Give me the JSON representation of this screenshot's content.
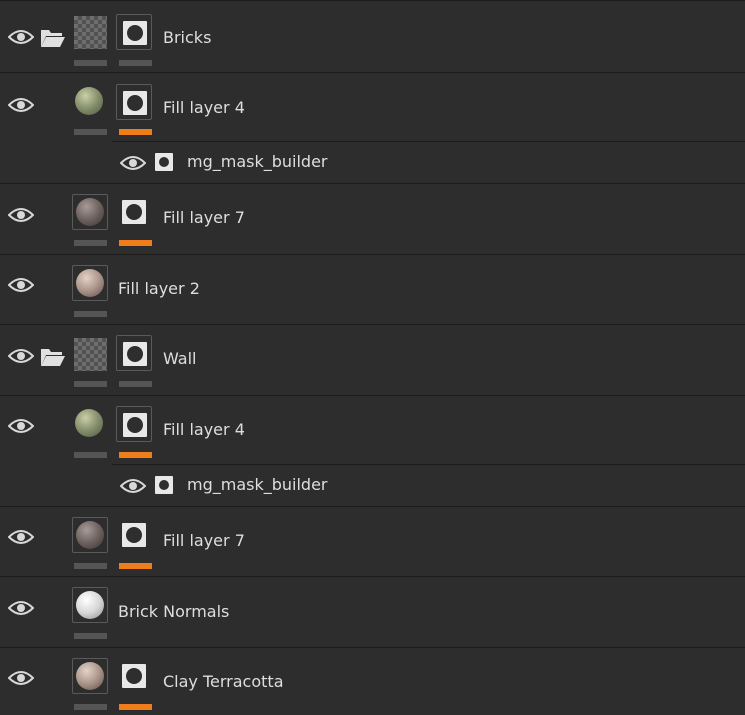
{
  "accent_color": "#ef7d1c",
  "layers": [
    {
      "name": "Bricks",
      "type": "folder",
      "visible": true,
      "content": "transparent",
      "mask": true,
      "mask_bar": "gray",
      "content_bar": "gray"
    },
    {
      "name": "Fill layer 4",
      "type": "fill",
      "visible": true,
      "content": "moss",
      "mask": true,
      "mask_bar": "orange",
      "content_bar": "gray",
      "effects": [
        {
          "name": "mg_mask_builder",
          "visible": true
        }
      ]
    },
    {
      "name": "Fill layer 7",
      "type": "fill",
      "visible": true,
      "content": "stone",
      "mask": true,
      "mask_bar": "orange",
      "content_bar": "gray"
    },
    {
      "name": "Fill layer 2",
      "type": "fill",
      "visible": true,
      "content": "clay",
      "mask": false,
      "content_bar": "gray"
    },
    {
      "name": "Wall",
      "type": "folder",
      "visible": true,
      "content": "transparent",
      "mask": true,
      "mask_bar": "gray",
      "content_bar": "gray"
    },
    {
      "name": "Fill layer 4",
      "type": "fill",
      "visible": true,
      "content": "moss",
      "mask": true,
      "mask_bar": "orange",
      "content_bar": "gray",
      "effects": [
        {
          "name": "mg_mask_builder",
          "visible": true
        }
      ]
    },
    {
      "name": "Fill layer 7",
      "type": "fill",
      "visible": true,
      "content": "stone",
      "mask": true,
      "mask_bar": "orange",
      "content_bar": "gray"
    },
    {
      "name": "Brick Normals",
      "type": "fill",
      "visible": true,
      "content": "normal",
      "mask": false,
      "content_bar": "gray"
    },
    {
      "name": "Clay Terracotta",
      "type": "fill",
      "visible": true,
      "content": "clay",
      "mask": true,
      "mask_bar": "orange",
      "content_bar": "gray"
    }
  ]
}
